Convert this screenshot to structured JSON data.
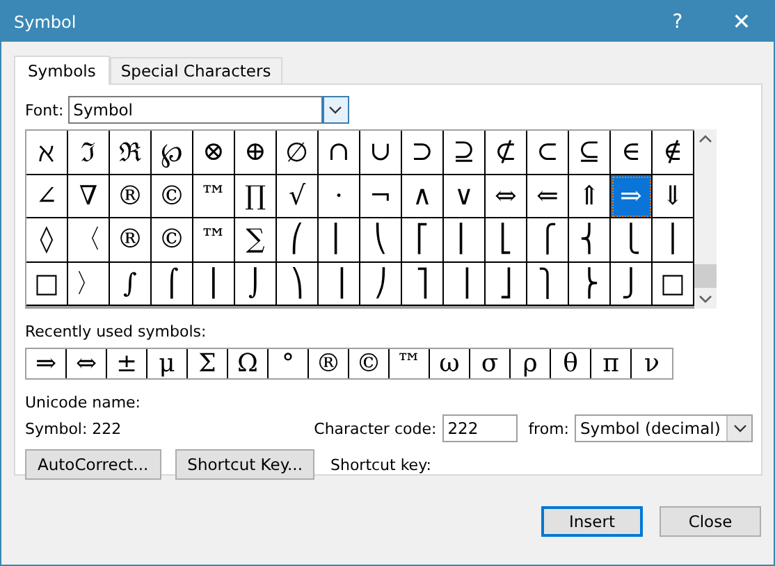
{
  "window": {
    "title": "Symbol",
    "help": "?",
    "close": "✕"
  },
  "tabs": [
    {
      "label": "Symbols",
      "selected": true
    },
    {
      "label": "Special Characters",
      "selected": false
    }
  ],
  "font": {
    "label": "Font:",
    "value": "Symbol"
  },
  "symbols": [
    [
      {
        "char": "ℵ",
        "selected": false
      },
      {
        "char": "ℑ",
        "selected": false
      },
      {
        "char": "ℜ",
        "selected": false
      },
      {
        "char": "℘",
        "selected": false
      },
      {
        "char": "⊗",
        "selected": false
      },
      {
        "char": "⊕",
        "selected": false
      },
      {
        "char": "∅",
        "selected": false
      },
      {
        "char": "∩",
        "selected": false
      },
      {
        "char": "∪",
        "selected": false
      },
      {
        "char": "⊃",
        "selected": false
      },
      {
        "char": "⊇",
        "selected": false
      },
      {
        "char": "⊄",
        "selected": false
      },
      {
        "char": "⊂",
        "selected": false
      },
      {
        "char": "⊆",
        "selected": false
      },
      {
        "char": "∈",
        "selected": false
      },
      {
        "char": "∉",
        "selected": false
      }
    ],
    [
      {
        "char": "∠",
        "selected": false
      },
      {
        "char": "∇",
        "selected": false
      },
      {
        "char": "®",
        "selected": false
      },
      {
        "char": "©",
        "selected": false
      },
      {
        "char": "™",
        "selected": false
      },
      {
        "char": "∏",
        "selected": false
      },
      {
        "char": "√",
        "selected": false
      },
      {
        "char": "⋅",
        "selected": false
      },
      {
        "char": "¬",
        "selected": false
      },
      {
        "char": "∧",
        "selected": false
      },
      {
        "char": "∨",
        "selected": false
      },
      {
        "char": "⇔",
        "selected": false
      },
      {
        "char": "⇐",
        "selected": false
      },
      {
        "char": "⇑",
        "selected": false
      },
      {
        "char": "⇒",
        "selected": true
      },
      {
        "char": "⇓",
        "selected": false
      }
    ],
    [
      {
        "char": "◊",
        "selected": false
      },
      {
        "char": "〈",
        "selected": false
      },
      {
        "char": "®",
        "selected": false
      },
      {
        "char": "©",
        "selected": false
      },
      {
        "char": "™",
        "selected": false
      },
      {
        "char": "∑",
        "selected": false
      },
      {
        "char": "⎛",
        "selected": false
      },
      {
        "char": "⎜",
        "selected": false
      },
      {
        "char": "⎝",
        "selected": false
      },
      {
        "char": "⎡",
        "selected": false
      },
      {
        "char": "⎢",
        "selected": false
      },
      {
        "char": "⎣",
        "selected": false
      },
      {
        "char": "⎧",
        "selected": false
      },
      {
        "char": "⎨",
        "selected": false
      },
      {
        "char": "⎩",
        "selected": false
      },
      {
        "char": "⎪",
        "selected": false
      }
    ],
    [
      {
        "char": "□",
        "selected": false
      },
      {
        "char": "〉",
        "selected": false
      },
      {
        "char": "∫",
        "selected": false
      },
      {
        "char": "⌠",
        "selected": false
      },
      {
        "char": "⎮",
        "selected": false
      },
      {
        "char": "⌡",
        "selected": false
      },
      {
        "char": "⎞",
        "selected": false
      },
      {
        "char": "⎟",
        "selected": false
      },
      {
        "char": "⎠",
        "selected": false
      },
      {
        "char": "⎤",
        "selected": false
      },
      {
        "char": "⎥",
        "selected": false
      },
      {
        "char": "⎦",
        "selected": false
      },
      {
        "char": "⎫",
        "selected": false
      },
      {
        "char": "⎬",
        "selected": false
      },
      {
        "char": "⎭",
        "selected": false
      },
      {
        "char": "□",
        "selected": false
      }
    ]
  ],
  "recent": {
    "label": "Recently used symbols:",
    "items": [
      "⇒",
      "⇔",
      "±",
      "μ",
      "Σ",
      "Ω",
      "°",
      "®",
      "©",
      "™",
      "ω",
      "σ",
      "ρ",
      "θ",
      "π",
      "ν"
    ]
  },
  "unicode_name": {
    "label": "Unicode name:",
    "value": "Symbol: 222"
  },
  "character_code": {
    "label": "Character code:",
    "value": "222"
  },
  "from": {
    "label": "from:",
    "value": "Symbol (decimal)"
  },
  "buttons": [
    {
      "label": "AutoCorrect...",
      "kind": "action",
      "default": false
    },
    {
      "label": "Shortcut Key...",
      "kind": "action",
      "default": false
    },
    {
      "label": "Insert",
      "kind": "footer",
      "default": true
    },
    {
      "label": "Close",
      "kind": "footer",
      "default": false
    }
  ],
  "shortcut_key": {
    "label": "Shortcut key:"
  }
}
